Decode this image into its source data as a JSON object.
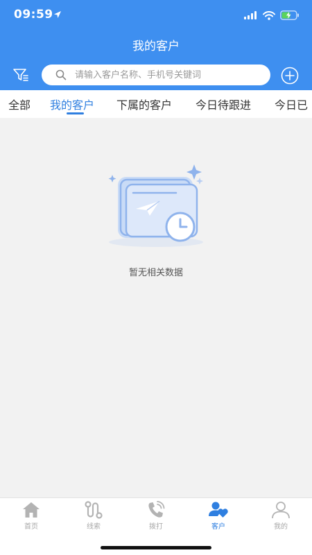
{
  "status_bar": {
    "time": "09:59"
  },
  "header": {
    "title": "我的客户",
    "search_placeholder": "请输入客户名称、手机号关键词"
  },
  "tabs": [
    {
      "label": "全部",
      "active": false
    },
    {
      "label": "我的客户",
      "active": true
    },
    {
      "label": "下属的客户",
      "active": false
    },
    {
      "label": "今日待跟进",
      "active": false
    },
    {
      "label": "今日已",
      "active": false
    }
  ],
  "empty_state": {
    "text": "暂无相关数据"
  },
  "tabbar": [
    {
      "label": "首页",
      "icon": "home-icon"
    },
    {
      "label": "线索",
      "icon": "route-icon"
    },
    {
      "label": "拨打",
      "icon": "phone-icon"
    },
    {
      "label": "客户",
      "icon": "customers-icon",
      "active": true
    },
    {
      "label": "我的",
      "icon": "profile-icon"
    }
  ],
  "colors": {
    "accent": "#3e8ff0",
    "active_text": "#2f7fe0",
    "inactive": "#a8a8a8",
    "background": "#f2f2f2"
  }
}
